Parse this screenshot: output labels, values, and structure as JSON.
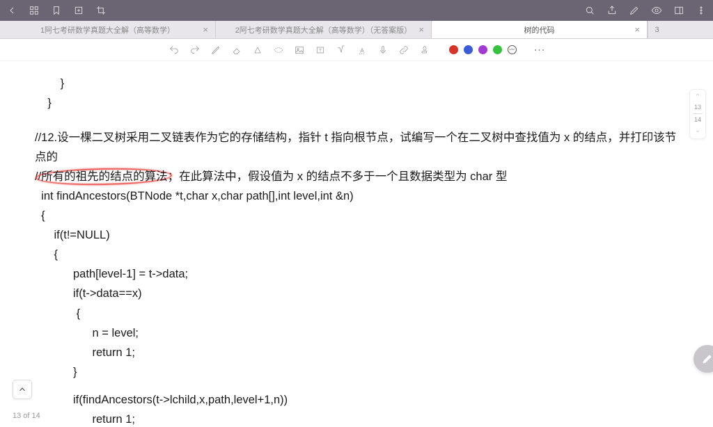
{
  "tabs": [
    {
      "label": "1阿七考研数学真题大全解（高等数学）"
    },
    {
      "label": "2阿七考研数学真题大全解（高等数学）（无答案版）"
    },
    {
      "label": "树的代码"
    }
  ],
  "tab_extra_count": "3",
  "colors": {
    "red": "#d7332b",
    "blue": "#3a5cd9",
    "purple": "#a23bd3",
    "green": "#36c23e",
    "dark": "#555"
  },
  "page_nav": {
    "cur": "13",
    "total": "14"
  },
  "page_info": "13 of 14",
  "code": {
    "l1": "        }",
    "l2": "    }",
    "l3": "//12.设一棵二叉树采用二叉链表作为它的存储结构，指针 t 指向根节点，试编写一个在二叉树中查找值为 x 的结点，并打印该节点的",
    "l4a": "//",
    "l4b": "所有的祖先的结点的算法",
    "l4c": "；在此算法中，假设值为 x 的结点不多于一个且数据类型为 char 型",
    "l5": "  int findAncestors(BTNode *t,char x,char path[],int level,int &n)",
    "l6": "  {",
    "l7": "      if(t!=NULL)",
    "l8": "      {",
    "l9": "            path[level-1] = t->data;",
    "l10": "            if(t->data==x)",
    "l11": "             {",
    "l12": "                  n = level;",
    "l13": "                  return 1;",
    "l14": "            }",
    "l15": "            if(findAncestors(t->lchild,x,path,level+1,n))",
    "l16": "                  return 1;"
  }
}
